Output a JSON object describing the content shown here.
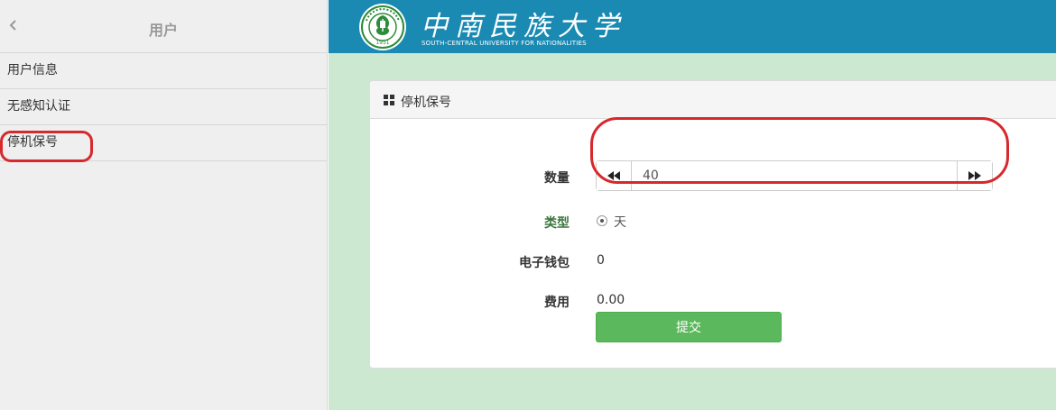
{
  "sidebar": {
    "title": "用户",
    "items": [
      {
        "label": "用户信息"
      },
      {
        "label": "无感知认证"
      },
      {
        "label": "停机保号"
      }
    ]
  },
  "banner": {
    "name_cn": "中南民族大学",
    "name_en": "SOUTH-CENTRAL UNIVERSITY FOR NATIONALITIES",
    "emblem_year": "1951"
  },
  "panel": {
    "title": "停机保号"
  },
  "form": {
    "quantity_label": "数量",
    "quantity_value": "40",
    "type_label": "类型",
    "type_option": "天",
    "wallet_label": "电子钱包",
    "wallet_value": "0",
    "fee_label": "费用",
    "fee_value": "0.00",
    "submit_label": "提交"
  },
  "colors": {
    "banner": "#1a8ab3",
    "main_bg": "#cde8d1",
    "submit": "#5cb85c",
    "highlight": "#d7282c",
    "type_label": "#3c763d"
  },
  "icons": {
    "back": "chevron-left-icon",
    "panel": "grid-icon",
    "decrement": "fast-backward-icon",
    "increment": "fast-forward-icon"
  }
}
